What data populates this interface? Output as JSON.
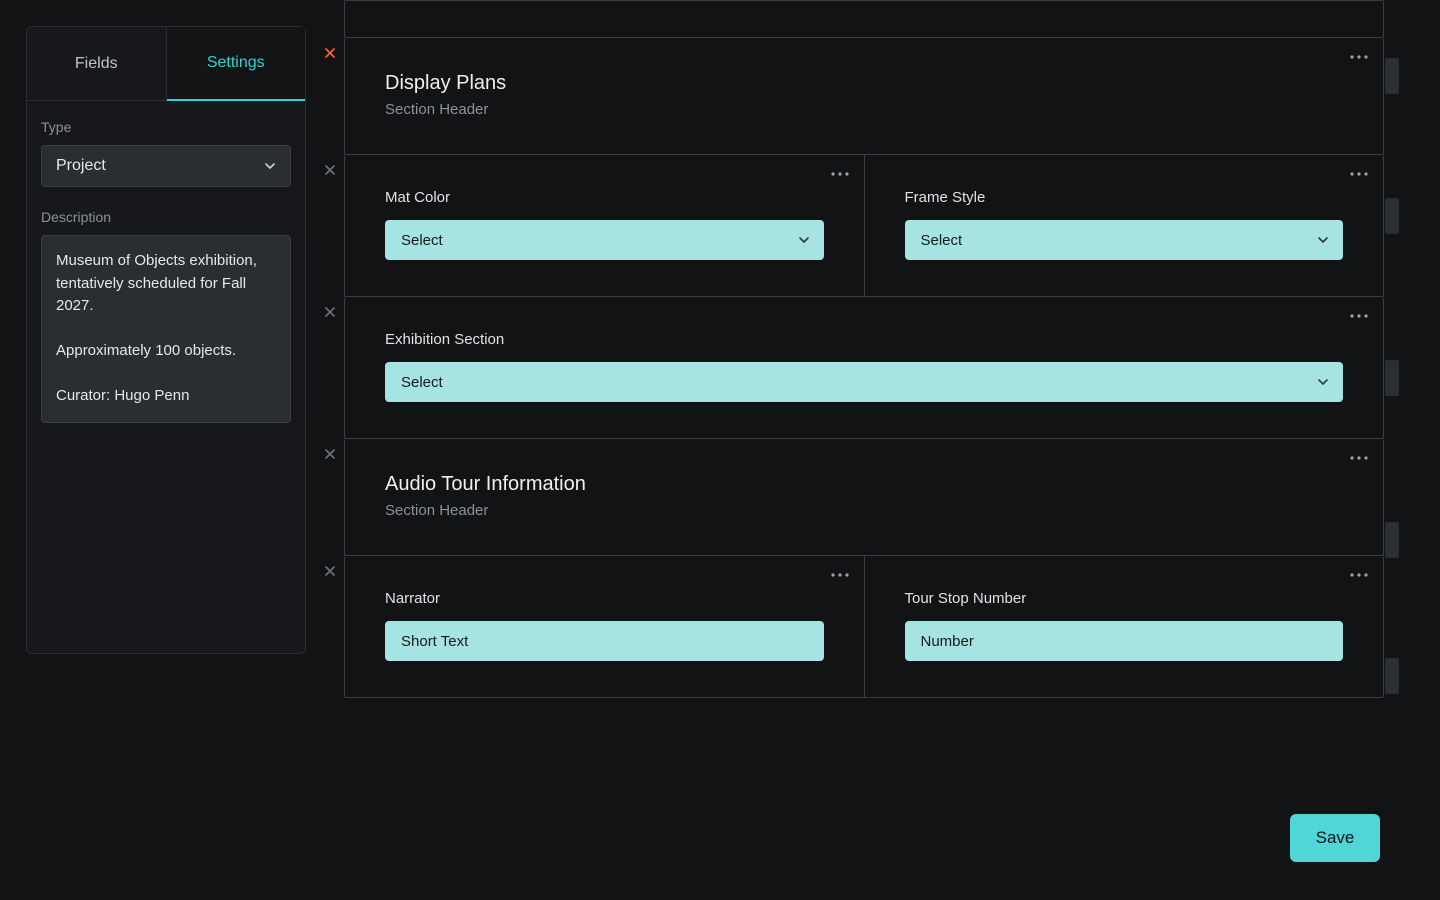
{
  "sidebar": {
    "tabs": {
      "fields": "Fields",
      "settings": "Settings"
    },
    "type_label": "Type",
    "type_value": "Project",
    "description_label": "Description",
    "description_text": "Museum of Objects exhibition, tentatively scheduled for Fall 2027.\n\nApproximately 100 objects.\n\nCurator: Hugo Penn"
  },
  "rows": [
    {
      "close_color": "#ff5a3c",
      "cells": [
        {
          "kind": "header",
          "title": "Display Plans",
          "subtitle": "Section Header"
        }
      ]
    },
    {
      "close_color": "#6a6f74",
      "cells": [
        {
          "kind": "select",
          "label": "Mat Color",
          "value": "Select"
        },
        {
          "kind": "select",
          "label": "Frame Style",
          "value": "Select"
        }
      ]
    },
    {
      "close_color": "#6a6f74",
      "cells": [
        {
          "kind": "select",
          "label": "Exhibition Section",
          "value": "Select"
        }
      ]
    },
    {
      "close_color": "#6a6f74",
      "cells": [
        {
          "kind": "header",
          "title": "Audio Tour Information",
          "subtitle": "Section Header"
        }
      ]
    },
    {
      "close_color": "#6a6f74",
      "cells": [
        {
          "kind": "text",
          "label": "Narrator",
          "value": "Short Text"
        },
        {
          "kind": "text",
          "label": "Tour Stop Number",
          "value": "Number"
        }
      ]
    }
  ],
  "footer": {
    "save": "Save"
  }
}
